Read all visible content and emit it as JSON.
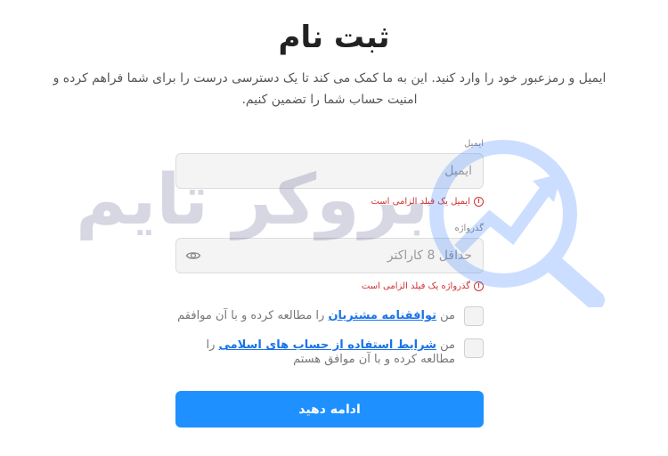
{
  "page": {
    "title": "ثبت نام",
    "subtitle": "ایمیل و رمزعبور خود را وارد کنید. این به ما کمک می کند تا یک دسترسی درست را برای شما فراهم کرده و امنیت حساب شما را تضمین کنیم."
  },
  "email": {
    "label": "ایمیل",
    "placeholder": "ایمیل",
    "error": "ایمیل یک فیلد الزامی است"
  },
  "password": {
    "label": "گذرواژه",
    "placeholder": "حداقل 8 کاراکتر",
    "error": "گذرواژه یک فیلد الزامی است"
  },
  "agreements": {
    "customer": {
      "prefix": "من ",
      "link": "توافقنامه مشتریان",
      "suffix": " را مطالعه کرده و با آن موافقم"
    },
    "islamic": {
      "prefix": "من ",
      "link": "شرایط استفاده از حساب های اسلامی",
      "suffix": " را مطالعه کرده و با آن موافق هستم"
    }
  },
  "submit_label": "ادامه دهید",
  "watermark": {
    "text": "بروکر تایم"
  },
  "colors": {
    "primary": "#1e90ff",
    "error": "#d32f2f",
    "link": "#1a73e8"
  },
  "icons": {
    "eye": "eye-icon",
    "error": "error-circle-icon"
  }
}
